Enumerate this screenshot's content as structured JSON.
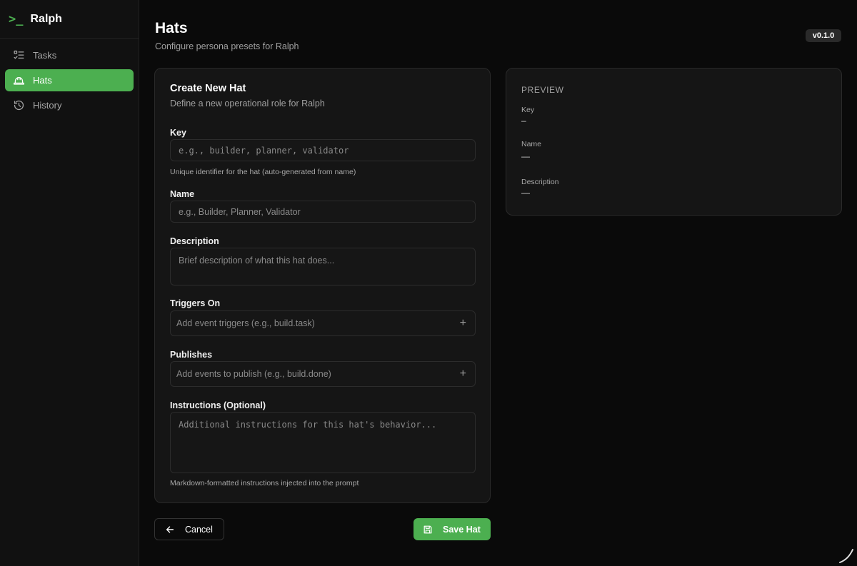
{
  "app": {
    "name": "Ralph",
    "version": "v0.1.0"
  },
  "sidebar": {
    "items": [
      {
        "label": "Tasks",
        "icon": "list-check-icon",
        "active": false
      },
      {
        "label": "Hats",
        "icon": "hard-hat-icon",
        "active": true
      },
      {
        "label": "History",
        "icon": "history-icon",
        "active": false
      }
    ]
  },
  "header": {
    "title": "Hats",
    "subtitle": "Configure persona presets for Ralph"
  },
  "form": {
    "title": "Create New Hat",
    "description": "Define a new operational role for Ralph",
    "key": {
      "label": "Key",
      "placeholder": "e.g., builder, planner, validator",
      "hint": "Unique identifier for the hat (auto-generated from name)"
    },
    "name": {
      "label": "Name",
      "placeholder": "e.g., Builder, Planner, Validator"
    },
    "description_field": {
      "label": "Description",
      "placeholder": "Brief description of what this hat does..."
    },
    "triggers": {
      "label": "Triggers On",
      "placeholder": "Add event triggers (e.g., build.task)"
    },
    "publishes": {
      "label": "Publishes",
      "placeholder": "Add events to publish (e.g., build.done)"
    },
    "instructions": {
      "label": "Instructions (Optional)",
      "placeholder": "Additional instructions for this hat's behavior...",
      "hint": "Markdown-formatted instructions injected into the prompt"
    }
  },
  "preview": {
    "heading": "PREVIEW",
    "key_label": "Key",
    "key_value": "–",
    "name_label": "Name",
    "name_value": "—",
    "description_label": "Description",
    "description_value": "—"
  },
  "actions": {
    "cancel_label": "Cancel",
    "save_label": "Save Hat"
  },
  "colors": {
    "accent": "#4caf50",
    "background": "#0a0a0a",
    "card": "#151515"
  }
}
